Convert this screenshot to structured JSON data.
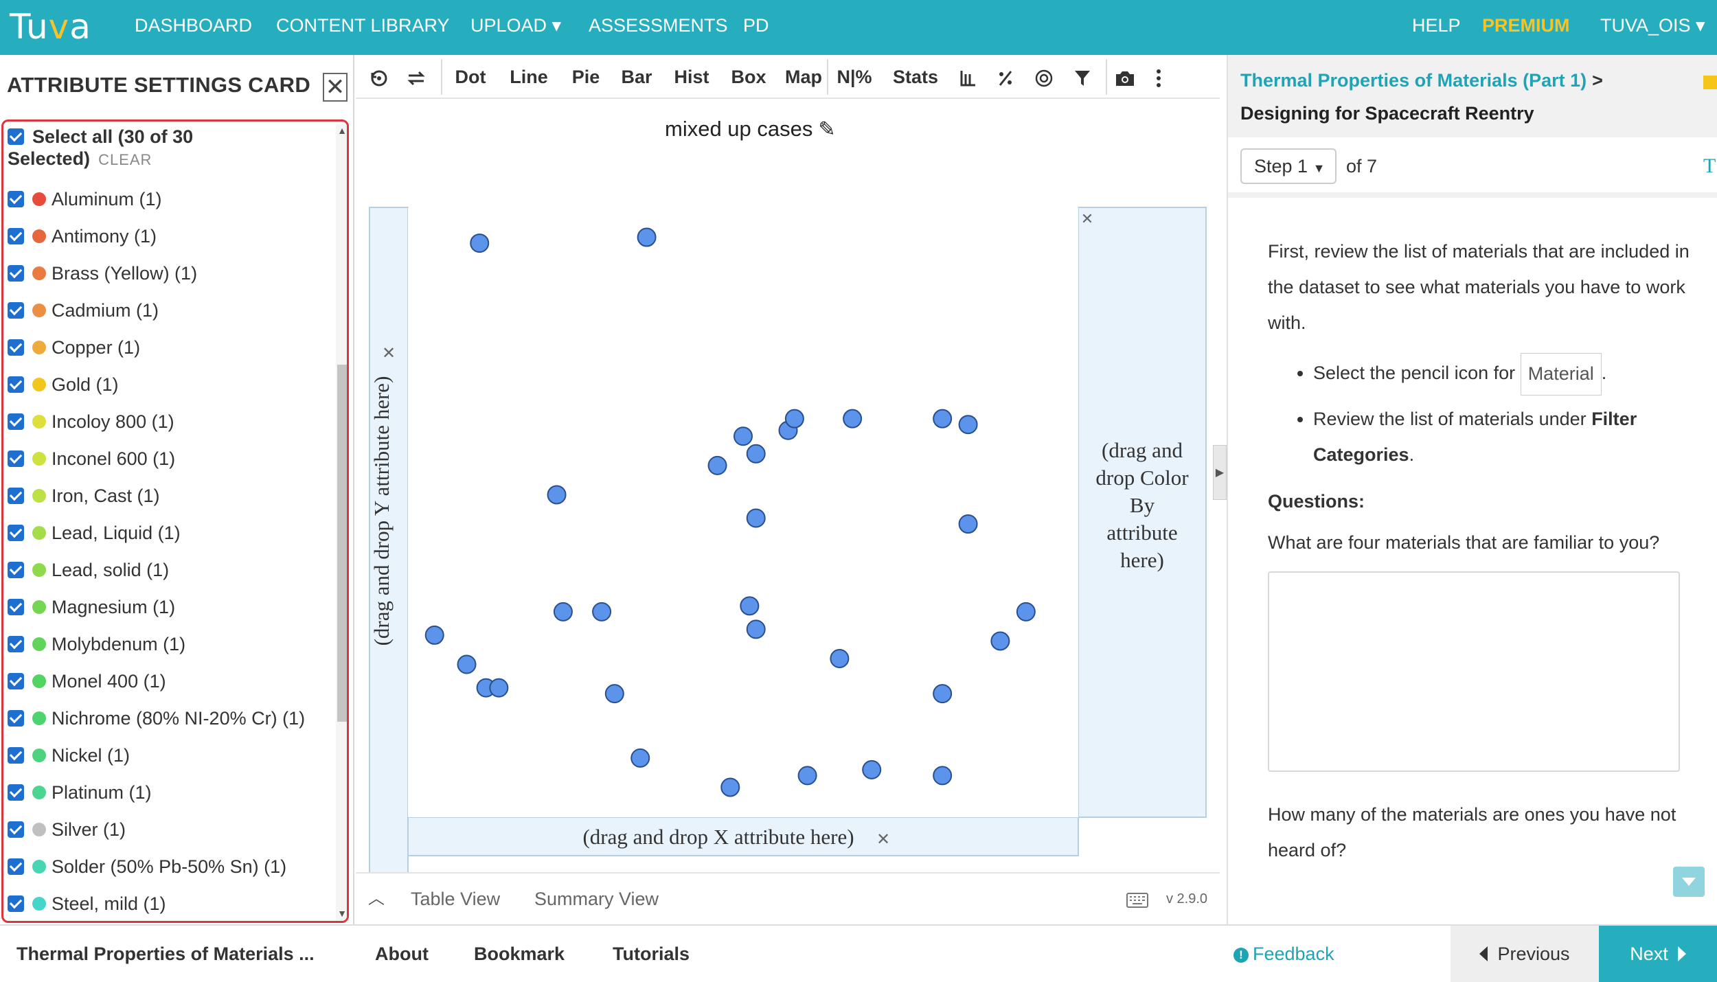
{
  "nav": {
    "logo": "Tuva",
    "items": [
      "DASHBOARD",
      "CONTENT LIBRARY",
      "UPLOAD ▾",
      "ASSESSMENTS",
      "PD"
    ],
    "right": [
      "HELP",
      "PREMIUM",
      "TUVA_OIS ▾"
    ],
    "accent_color": "#26aebf",
    "premium_color": "#f7c325"
  },
  "attribute_panel": {
    "title": "ATTRIBUTE SETTINGS CARD",
    "close_icon": "close-x-icon",
    "select_all_label": "Select all (30 of 30 Selected)",
    "clear_label": "CLEAR",
    "items": [
      {
        "label": "Aluminum (1)",
        "color": "#e84a3c"
      },
      {
        "label": "Antimony (1)",
        "color": "#e8663c"
      },
      {
        "label": "Brass (Yellow) (1)",
        "color": "#ea7a40"
      },
      {
        "label": "Cadmium (1)",
        "color": "#eb8f42"
      },
      {
        "label": "Copper (1)",
        "color": "#eeaa3a"
      },
      {
        "label": "Gold (1)",
        "color": "#f2c71c"
      },
      {
        "label": "Incoloy 800 (1)",
        "color": "#dde03a"
      },
      {
        "label": "Inconel 600 (1)",
        "color": "#cde23c"
      },
      {
        "label": "Iron, Cast (1)",
        "color": "#bde045"
      },
      {
        "label": "Lead, Liquid (1)",
        "color": "#a6dc48"
      },
      {
        "label": "Lead, solid (1)",
        "color": "#8fda4c"
      },
      {
        "label": "Magnesium (1)",
        "color": "#74d752"
      },
      {
        "label": "Molybdenum (1)",
        "color": "#60d55a"
      },
      {
        "label": "Monel 400 (1)",
        "color": "#52d463"
      },
      {
        "label": "Nichrome (80% NI-20% Cr) (1)",
        "color": "#4ed46f"
      },
      {
        "label": "Nickel (1)",
        "color": "#4bd47d"
      },
      {
        "label": "Platinum (1)",
        "color": "#4ad590"
      },
      {
        "label": "Silver (1)",
        "color": "#c0c0c0"
      },
      {
        "label": "Solder (50% Pb-50% Sn) (1)",
        "color": "#46d6b4"
      },
      {
        "label": "Steel, mild (1)",
        "color": "#44d6c8"
      }
    ]
  },
  "toolbar": {
    "icons": [
      "rescale-icon",
      "shuffle-icon"
    ],
    "labels": [
      "Dot",
      "Line",
      "Pie",
      "Bar",
      "Hist",
      "Box",
      "Map",
      "N|%",
      "Stats"
    ],
    "tool_icons": [
      "axis-icon",
      "percent-icon",
      "target-icon",
      "filter-icon",
      "camera-icon",
      "more-vertical-icon"
    ]
  },
  "graph": {
    "title": "mixed up cases",
    "y_drop_label": "(drag and drop Y attribute here)",
    "x_drop_label": "(drag and drop X attribute here)",
    "color_drop_label": "(drag and drop Color By attribute here)",
    "point_color": "#5b94ea"
  },
  "chart_data": {
    "type": "scatter",
    "title": "mixed up cases",
    "xlabel": "",
    "ylabel": "",
    "points": [
      [
        0.09,
        0.04
      ],
      [
        0.35,
        0.03
      ],
      [
        0.21,
        0.47
      ],
      [
        0.46,
        0.42
      ],
      [
        0.52,
        0.51
      ],
      [
        0.52,
        0.4
      ],
      [
        0.5,
        0.37
      ],
      [
        0.57,
        0.36
      ],
      [
        0.58,
        0.34
      ],
      [
        0.67,
        0.34
      ],
      [
        0.81,
        0.34
      ],
      [
        0.85,
        0.35
      ],
      [
        0.85,
        0.52
      ],
      [
        0.02,
        0.71
      ],
      [
        0.07,
        0.76
      ],
      [
        0.1,
        0.8
      ],
      [
        0.12,
        0.8
      ],
      [
        0.22,
        0.67
      ],
      [
        0.28,
        0.67
      ],
      [
        0.3,
        0.81
      ],
      [
        0.51,
        0.66
      ],
      [
        0.52,
        0.7
      ],
      [
        0.65,
        0.75
      ],
      [
        0.9,
        0.72
      ],
      [
        0.94,
        0.67
      ],
      [
        0.81,
        0.81
      ],
      [
        0.34,
        0.92
      ],
      [
        0.48,
        0.97
      ],
      [
        0.6,
        0.95
      ],
      [
        0.7,
        0.94
      ],
      [
        0.81,
        0.95
      ]
    ]
  },
  "bottom_bar": {
    "table_view": "Table View",
    "summary_view": "Summary View",
    "version": "v 2.9.0"
  },
  "right_panel": {
    "breadcrumb": "Thermal Properties of Materials (Part 1)",
    "breadcrumb_sep": ">",
    "subtitle": "Designing for Spacecraft Reentry",
    "step_label": "Step 1",
    "step_of": "of 7",
    "step_t": "T",
    "intro": "First, review the list of materials that are included in the dataset to see what materials you have to work with.",
    "bullet1_pre": "Select the pencil icon for",
    "bullet1_box": "Material",
    "bullet1_post": ".",
    "bullet2_pre": "Review the list of materials under",
    "bullet2_bold": "Filter Categories",
    "bullet2_post": ".",
    "questions_heading": "Questions:",
    "q1": "What are four materials that are familiar to you?",
    "q2": "How many of the materials are ones you have not heard of?"
  },
  "footer": {
    "title": "Thermal Properties of Materials ...",
    "about": "About",
    "bookmark": "Bookmark",
    "tutorials": "Tutorials",
    "feedback": "Feedback",
    "previous": "Previous",
    "next": "Next"
  }
}
